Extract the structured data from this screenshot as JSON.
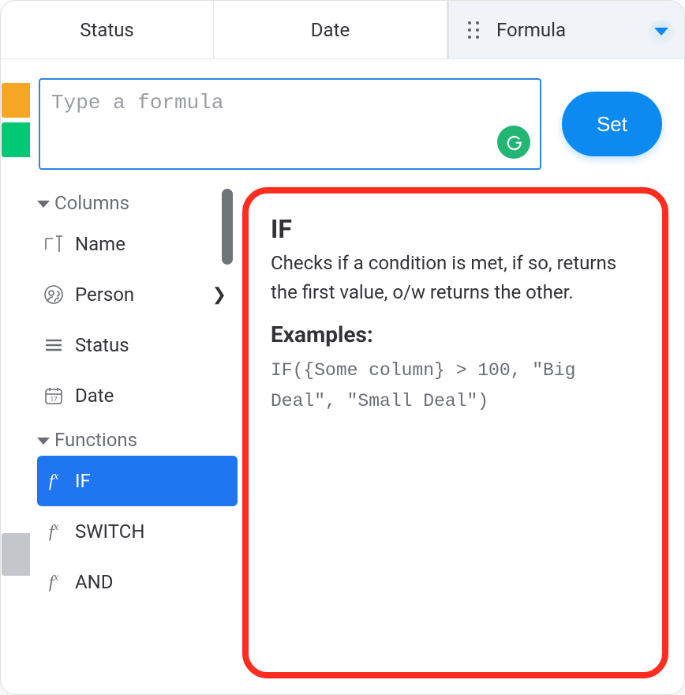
{
  "header": {
    "status_label": "Status",
    "date_label": "Date",
    "formula_label": "Formula"
  },
  "formula_bar": {
    "placeholder": "Type a formula",
    "set_label": "Set"
  },
  "sidebar": {
    "columns_header": "Columns",
    "functions_header": "Functions",
    "columns": [
      {
        "label": "Name",
        "icon": "text"
      },
      {
        "label": "Person",
        "icon": "person",
        "has_submenu": true
      },
      {
        "label": "Status",
        "icon": "status"
      },
      {
        "label": "Date",
        "icon": "date"
      }
    ],
    "functions": [
      {
        "label": "IF",
        "selected": true
      },
      {
        "label": "SWITCH"
      },
      {
        "label": "AND"
      }
    ]
  },
  "doc": {
    "title": "IF",
    "description": "Checks if a condition is met, if so, returns the first value, o/w returns the other.",
    "examples_label": "Examples:",
    "example_code": "IF({Some column} > 100, \"Big Deal\", \"Small Deal\")"
  },
  "row_colors": {
    "row1": "orange",
    "row2": "green"
  }
}
